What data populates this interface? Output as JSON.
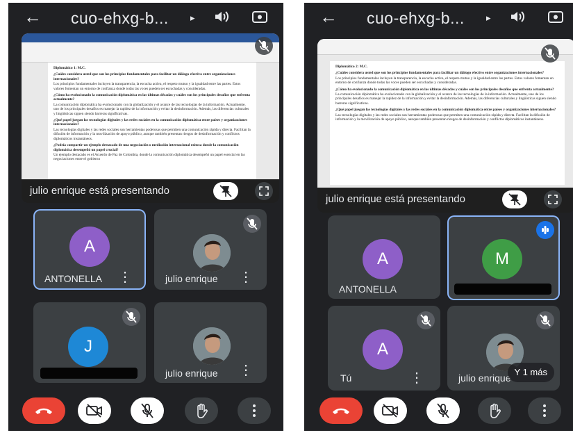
{
  "left": {
    "topbar": {
      "back_icon": "arrow-left-icon",
      "meeting_code": "cuo-ehxg-b...",
      "caret": "▸"
    },
    "presentation": {
      "label": "julio enrique está presentando",
      "doc": {
        "heading": "Diplomático 1: M.C.",
        "q1": "¿Cuáles considera usted que son los principios fundamentales para facilitar un diálogo efectivo entre organizaciones internacionales?",
        "p1": "Los principios fundamentales incluyen la transparencia, la escucha activa, el respeto mutuo y la igualdad entre las partes. Estos valores fomentan un entorno de confianza donde todas las voces pueden ser escuchadas y consideradas.",
        "q2": "¿Cómo ha evolucionado la comunicación diplomática en las últimas décadas y cuáles son los principales desafíos que enfrenta actualmente?",
        "p2": "La comunicación diplomática ha evolucionado con la globalización y el avance de las tecnologías de la información. Actualmente, uno de los principales desafíos es manejar la rapidez de la información y evitar la desinformación. Además, las diferencias culturales y lingüísticas siguen siendo barreras significativas.",
        "q3": "¿Qué papel juegan las tecnologías digitales y las redes sociales en la comunicación diplomática entre países y organizaciones internacionales?",
        "p3": "Las tecnologías digitales y las redes sociales son herramientas poderosas que permiten una comunicación rápida y directa. Facilitan la difusión de información y la movilización de apoyo público, aunque también presentan riesgos de desinformación y conflictos diplomáticos instantáneos.",
        "q4": "¿Podría compartir un ejemplo destacado de una negociación o mediación internacional exitosa donde la comunicación diplomática desempeñó un papel crucial?",
        "p4": "Un ejemplo destacado es el Acuerdo de Paz de Colombia, donde la comunicación diplomática desempeñó un papel esencial en las negociaciones entre el gobierno"
      }
    },
    "tiles": [
      {
        "type": "avatar",
        "initial": "A",
        "color": "#8e5fc8",
        "name": "ANTONELLA"
      },
      {
        "type": "photo",
        "name": "julio enrique",
        "muted": true
      },
      {
        "type": "avatar",
        "initial": "J",
        "color": "#1e88d6",
        "name": "",
        "muted": true
      },
      {
        "type": "photo",
        "name": "julio enrique"
      }
    ]
  },
  "right": {
    "topbar": {
      "back_icon": "arrow-left-icon",
      "meeting_code": "cuo-ehxg-b...",
      "caret": "▸"
    },
    "presentation": {
      "label": "julio enrique está presentando",
      "doc": {
        "heading": "Diplomático 2: M.C.",
        "q1": "¿Cuáles considera usted que son los principios fundamentales para facilitar un diálogo efectivo entre organizaciones internacionales?",
        "p1": "Los principios fundamentales incluyen la transparencia, la escucha activa, el respeto mutuo y la igualdad entre las partes. Estos valores fomentan un entorno de confianza donde todas las voces pueden ser escuchadas y consideradas.",
        "q2": "¿Cómo ha evolucionado la comunicación diplomática en las últimas décadas y cuáles son los principales desafíos que enfrenta actualmente?",
        "p2": "La comunicación diplomática ha evolucionado con la globalización y el avance de las tecnologías de la información. Actualmente, uno de los principales desafíos es manejar la rapidez de la información y evitar la desinformación. Además, las diferencias culturales y lingüísticas siguen siendo barreras significativas.",
        "q3": "¿Qué papel juegan las tecnologías digitales y las redes sociales en la comunicación diplomática entre países y organizaciones internacionales?",
        "p3": "Las tecnologías digitales y las redes sociales son herramientas poderosas que permiten una comunicación rápida y directa. Facilitan la difusión de información y la movilización de apoyo público, aunque también presentan riesgos de desinformación y conflictos diplomáticos instantáneos."
      }
    },
    "tiles": [
      {
        "type": "avatar",
        "initial": "A",
        "color": "#8e5fc8",
        "name": "ANTONELLA"
      },
      {
        "type": "avatar",
        "initial": "M",
        "color": "#3f9d46",
        "name": "",
        "speaking": true
      },
      {
        "type": "avatar",
        "initial": "A",
        "color": "#8e5fc8",
        "name": "Tú",
        "muted": true
      },
      {
        "type": "photo",
        "name": "julio enrique",
        "muted": true,
        "more": "Y 1 más"
      }
    ]
  },
  "controls": [
    "end-call",
    "camera-off",
    "mic-off",
    "raise-hand",
    "more-options"
  ],
  "colors": {
    "bg": "#202124",
    "tile": "#3c4043",
    "end": "#ea4335",
    "active": "#8ab4f8"
  }
}
